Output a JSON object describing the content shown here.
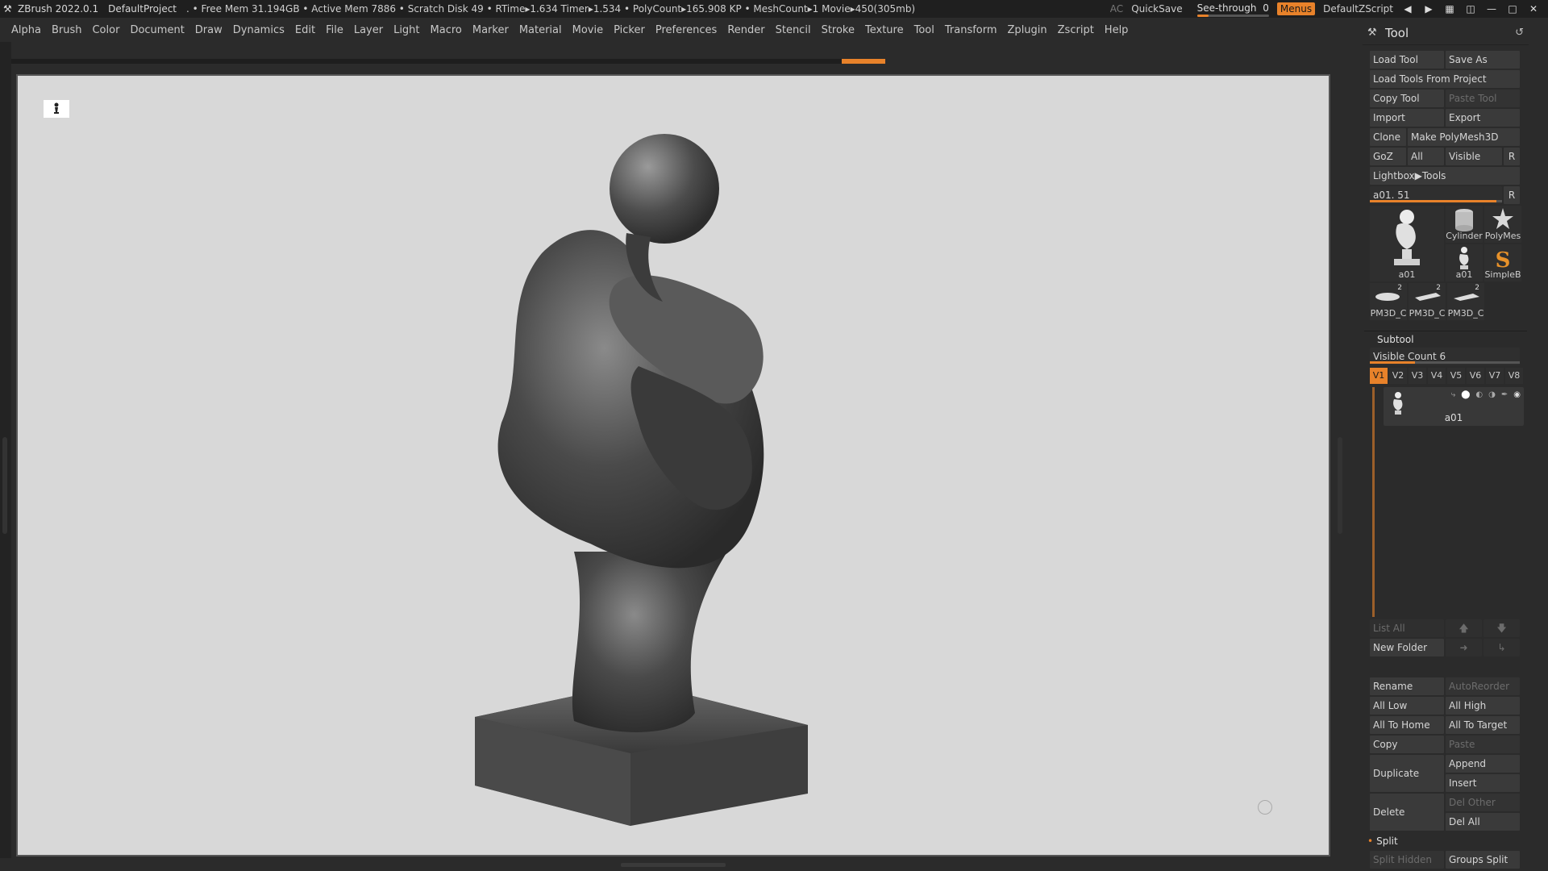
{
  "titlebar": {
    "app": "ZBrush 2022.0.1",
    "project": "DefaultProject",
    "stats": ". • Free Mem 31.194GB • Active Mem 7886 • Scratch Disk 49 •  RTime▸1.634 Timer▸1.534 • PolyCount▸165.908 KP  • MeshCount▸1  Movie▸450(305mb)",
    "ac": "AC",
    "quicksave": "QuickSave",
    "see_through_label": "See-through",
    "see_through_value": "0",
    "see_through_level": 0.05,
    "menus": "Menus",
    "script": "DefaultZScript"
  },
  "menubar": [
    "Alpha",
    "Brush",
    "Color",
    "Document",
    "Draw",
    "Dynamics",
    "Edit",
    "File",
    "Layer",
    "Light",
    "Macro",
    "Marker",
    "Material",
    "Movie",
    "Picker",
    "Preferences",
    "Render",
    "Stencil",
    "Stroke",
    "Texture",
    "Tool",
    "Transform",
    "Zplugin",
    "Zscript",
    "Help"
  ],
  "panel": {
    "title": "Tool",
    "load_tool": "Load Tool",
    "save_as": "Save As",
    "load_from_project": "Load Tools From Project",
    "copy_tool": "Copy Tool",
    "paste_tool": "Paste Tool",
    "import": "Import",
    "export": "Export",
    "clone": "Clone",
    "make_polymesh": "Make PolyMesh3D",
    "goz": "GoZ",
    "all": "All",
    "visible": "Visible",
    "r": "R",
    "lightbox": "Lightbox▶Tools",
    "tool_slider_label": "a01. 51",
    "tool_slider_level": 0.96,
    "tiles": {
      "main": "a01",
      "cylinder": "Cylinder",
      "polymesh": "PolyMes",
      "a01_small": "a01",
      "simpleb": "SimpleB",
      "pm1": "PM3D_C",
      "pm2": "PM3D_C",
      "pm3": "PM3D_C",
      "pm_badge": "2"
    },
    "subtool_title": "Subtool",
    "visible_count": "Visible Count 6",
    "visible_count_level": 0.3,
    "vtabs": [
      "V1",
      "V2",
      "V3",
      "V4",
      "V5",
      "V6",
      "V7",
      "V8"
    ],
    "subtool_name": "a01",
    "list_all": "List All",
    "new_folder": "New Folder",
    "rename": "Rename",
    "autoreorder": "AutoReorder",
    "all_low": "All Low",
    "all_high": "All High",
    "all_to_home": "All To Home",
    "all_to_target": "All To Target",
    "copy": "Copy",
    "paste": "Paste",
    "duplicate": "Duplicate",
    "append": "Append",
    "insert": "Insert",
    "delete": "Delete",
    "del_other": "Del Other",
    "del_all": "Del All",
    "split": "Split",
    "split_hidden": "Split Hidden",
    "groups_split": "Groups Split"
  }
}
